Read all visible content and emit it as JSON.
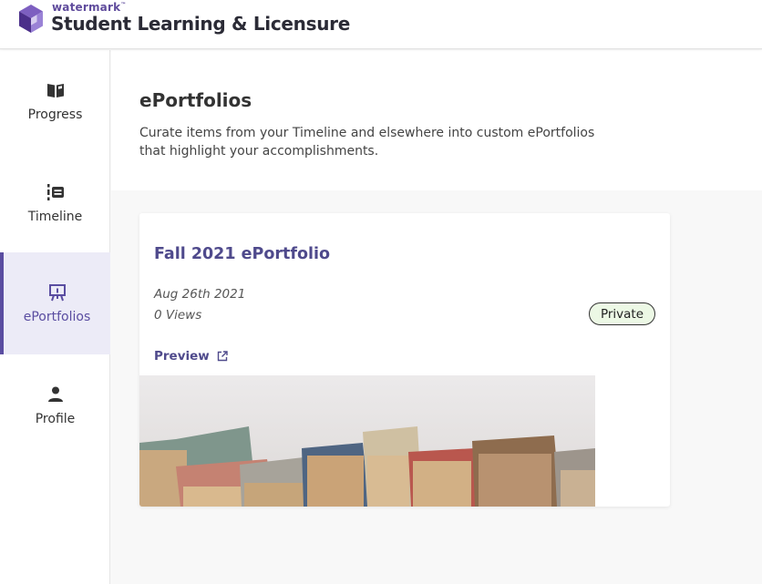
{
  "header": {
    "brand_small": "watermark",
    "brand_tm": "™",
    "app_title": "Student Learning & Licensure"
  },
  "sidebar": {
    "items": [
      {
        "label": "Progress",
        "icon": "book-icon",
        "active": false
      },
      {
        "label": "Timeline",
        "icon": "timeline-icon",
        "active": false
      },
      {
        "label": "ePortfolios",
        "icon": "presentation-icon",
        "active": true
      },
      {
        "label": "Profile",
        "icon": "person-icon",
        "active": false
      }
    ]
  },
  "main": {
    "title": "ePortfolios",
    "description": "Curate items from your Timeline and elsewhere into custom ePortfolios that highlight your accomplishments."
  },
  "card": {
    "title": "Fall 2021 ePortfolio",
    "date": "Aug 26th 2021",
    "views": "0 Views",
    "badge": "Private",
    "preview_label": "Preview",
    "preview_icon": "external-link-icon",
    "cover_image": "books-cover-image"
  },
  "colors": {
    "accent": "#5a4da1",
    "link": "#4f4a8c",
    "active_bg": "#ecebf7",
    "badge_bg": "#ecf8e5"
  }
}
